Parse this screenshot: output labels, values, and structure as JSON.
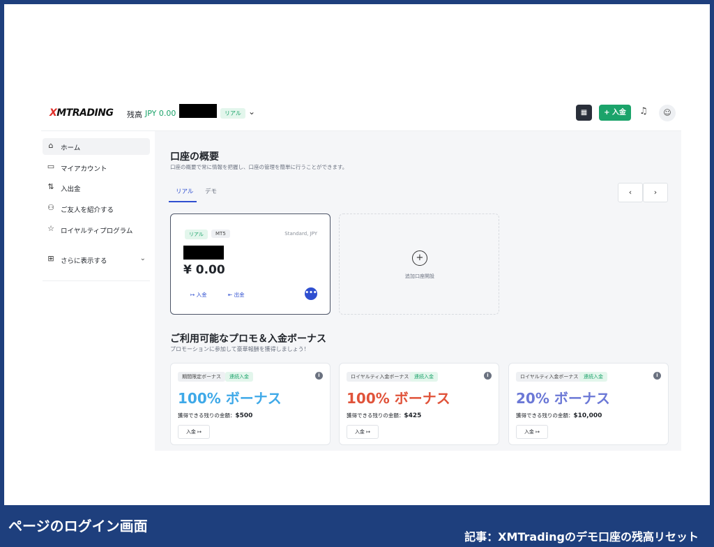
{
  "header": {
    "logo_x": "X",
    "logo_rest": "MTRADING",
    "balance_label": "残高",
    "balance_value": "JPY 0.00",
    "account_badge": "リアル",
    "deposit_label": "+ 入金"
  },
  "sidebar": {
    "items": [
      {
        "label": "ホーム",
        "icon": "home-icon",
        "glyph": "⌂"
      },
      {
        "label": "マイアカウント",
        "icon": "card-icon",
        "glyph": "▭"
      },
      {
        "label": "入出金",
        "icon": "transfer-icon",
        "glyph": "⇅"
      },
      {
        "label": "ご友人を紹介する",
        "icon": "users-icon",
        "glyph": "⚇"
      },
      {
        "label": "ロイヤルティプログラム",
        "icon": "star-icon",
        "glyph": "☆"
      }
    ],
    "more_label": "さらに表示する",
    "more_icon": "grid-icon"
  },
  "overview": {
    "title": "口座の概要",
    "subtitle": "口座の概要で常に情報を把握し、口座の管理を簡単に行うことができます。",
    "tabs": [
      "リアル",
      "デモ"
    ]
  },
  "account_card": {
    "badge_type": "リアル",
    "badge_platform": "MT5",
    "account_type": "Standard, JPY",
    "amount": "¥ 0.00",
    "deposit_link": "入金",
    "withdraw_link": "出金"
  },
  "add_account": {
    "label": "追加口座開設"
  },
  "promos": {
    "title": "ご利用可能なプロモ＆入金ボーナス",
    "subtitle": "プロモーションに参加して豪華報酬を獲得しましょう！",
    "items": [
      {
        "tag1": "期間限定ボーナス",
        "tag2": "連続入金",
        "bonus": "100% ボーナス",
        "color": "#3fa9e8",
        "remain_label": "獲得できる残りの金額：",
        "remain_value": "$500",
        "button": "入金"
      },
      {
        "tag1": "ロイヤルティ入金ボーナス",
        "tag2": "連続入金",
        "bonus": "100% ボーナス",
        "color": "#e0533a",
        "remain_label": "獲得できる残りの金額：",
        "remain_value": "$425",
        "button": "入金"
      },
      {
        "tag1": "ロイヤルティ入金ボーナス",
        "tag2": "連続入金",
        "bonus": "20% ボーナス",
        "color": "#6b78d6",
        "remain_label": "獲得できる残りの金額：",
        "remain_value": "$10,000",
        "button": "入金"
      }
    ]
  },
  "footer": {
    "page_label": "ページのログイン画面",
    "article_label": "記事：XMTradingのデモ口座の残高リセット"
  }
}
